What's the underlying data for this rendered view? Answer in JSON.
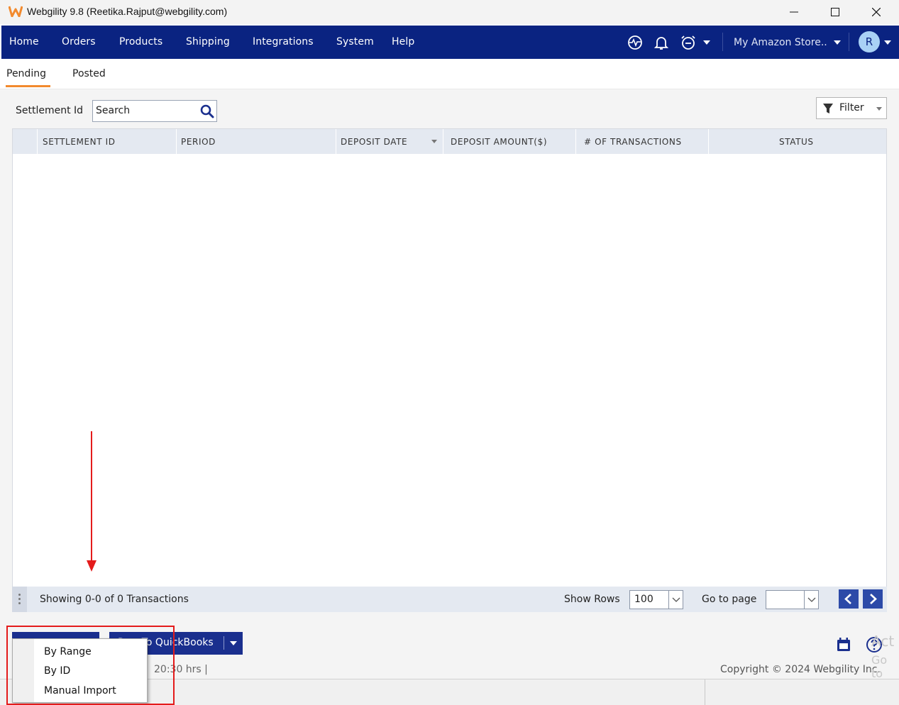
{
  "window": {
    "title": "Webgility 9.8 (Reetika.Rajput@webgility.com)"
  },
  "nav": {
    "items": [
      "Home",
      "Orders",
      "Products",
      "Shipping",
      "Integrations",
      "System",
      "Help"
    ],
    "store": "My Amazon Store..",
    "avatar_initial": "R",
    "icons": [
      "activity-icon",
      "bell-icon",
      "alarm-clock-icon"
    ]
  },
  "tabs": [
    "Pending",
    "Posted"
  ],
  "active_tab": "Pending",
  "toolbar": {
    "search_label": "Settlement Id",
    "search_placeholder": "Search",
    "filter_label": "Filter"
  },
  "table": {
    "columns": [
      "SETTLEMENT ID",
      "PERIOD",
      "DEPOSIT DATE",
      "DEPOSIT AMOUNT($)",
      "# OF TRANSACTIONS",
      "STATUS"
    ],
    "rows": []
  },
  "pager": {
    "summary": "Showing 0-0 of 0 Transactions",
    "show_rows_label": "Show Rows",
    "show_rows_value": "100",
    "go_to_page_label": "Go to page",
    "go_to_page_value": ""
  },
  "actions": {
    "post_to_qb": "Post To QuickBooks",
    "last_sync_fragment": "20:30 hrs |",
    "copyright": "Copyright © 2024 Webgility Inc."
  },
  "menu": {
    "items": [
      "By Range",
      "By ID",
      "Manual Import"
    ]
  },
  "watermark": {
    "line1": "Act",
    "line2": "Go to"
  },
  "colors": {
    "nav_bg": "#0a2381",
    "tab_accent": "#f28a2e",
    "annotation": "#e41b1b",
    "button": "#1a2f8e"
  }
}
